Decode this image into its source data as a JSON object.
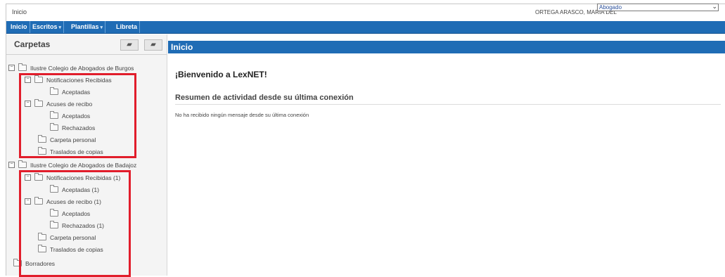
{
  "topbar": {
    "crumb": "Inicio",
    "user": "ORTEGA ARASCO, MARIA DEL",
    "role": "Abogado"
  },
  "nav": {
    "items": [
      {
        "label": "Inicio"
      },
      {
        "label": "Escritos"
      },
      {
        "label": "Plantillas"
      },
      {
        "label": "Libreta"
      }
    ]
  },
  "sidebar": {
    "title": "Carpetas",
    "tree": {
      "burgos": {
        "label": "Ilustre Colegio de Abogados de Burgos",
        "notificaciones": "Notificaciones Recibidas",
        "aceptadas": "Aceptadas",
        "acuses": "Acuses de recibo",
        "aceptados": "Aceptados",
        "rechazados": "Rechazados",
        "personal": "Carpeta personal",
        "traslados": "Traslados de copias"
      },
      "badajoz": {
        "label": "Ilustre Colegio de Abogados de Badajoz",
        "notificaciones": "Notificaciones Recibidas (1)",
        "aceptadas": "Aceptadas (1)",
        "acuses": "Acuses de recibo (1)",
        "aceptados": "Aceptados",
        "rechazados": "Rechazados (1)",
        "personal": "Carpeta personal",
        "traslados": "Traslados de copias"
      },
      "borradores": "Borradores"
    }
  },
  "main": {
    "title": "Inicio",
    "welcome": "¡Bienvenido a LexNET!",
    "summary_title": "Resumen de actividad desde su última conexión",
    "no_messages": "No ha recibido ningún mensaje desde su última conexión"
  },
  "colors": {
    "nav_blue": "#1f6cb5",
    "highlight_red": "#e11d2b"
  }
}
